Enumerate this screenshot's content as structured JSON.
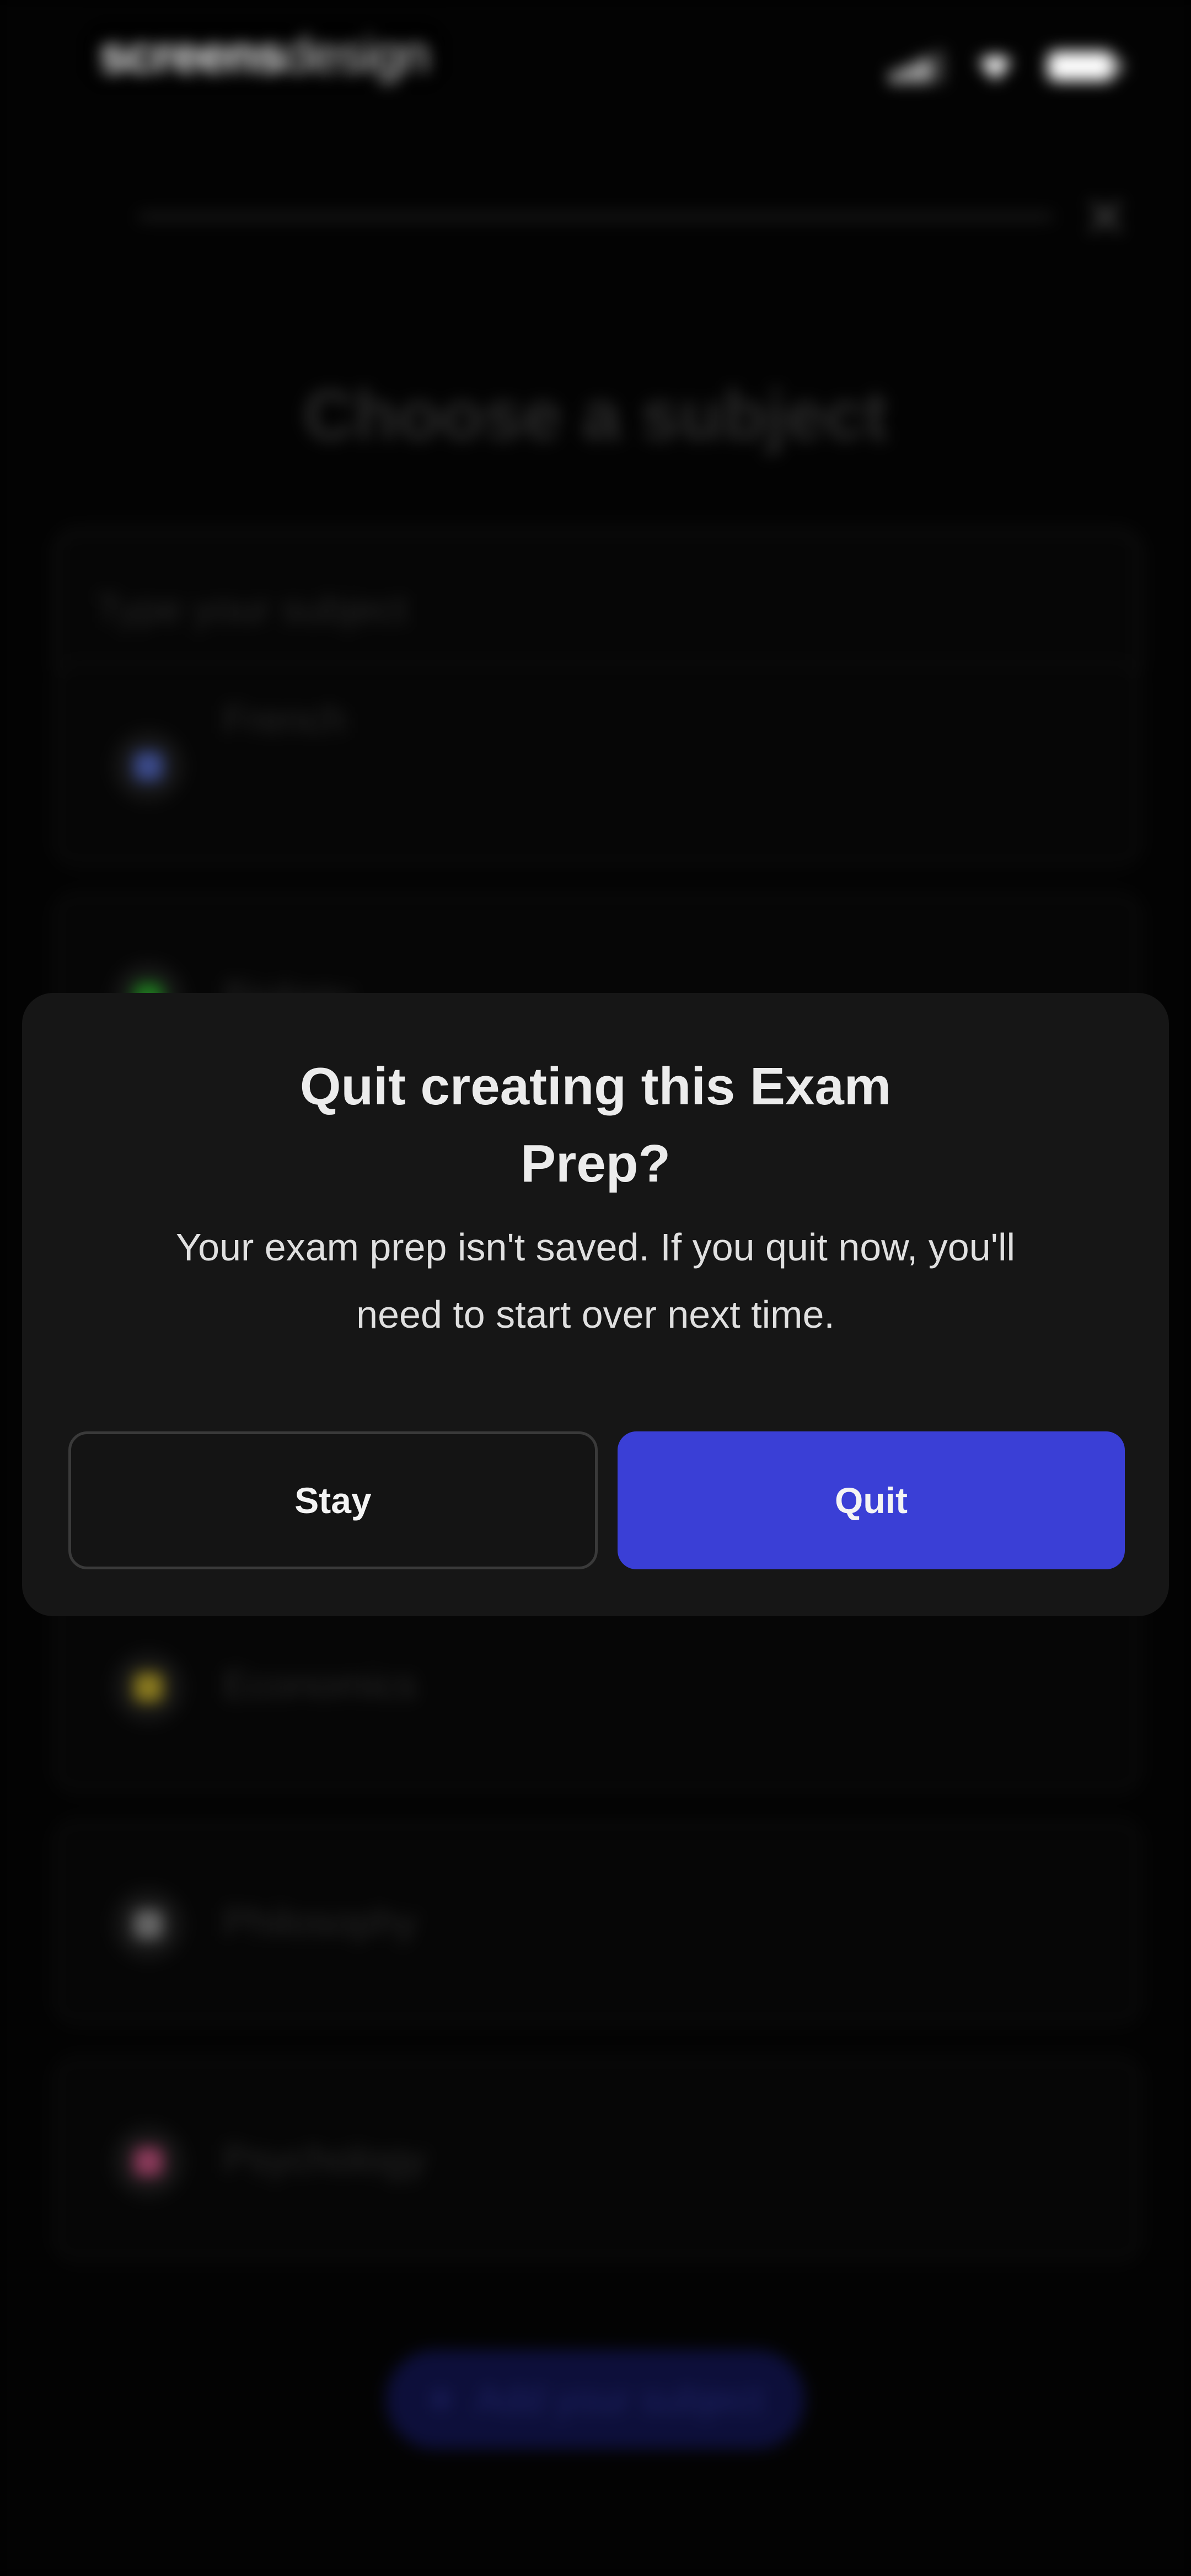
{
  "status_bar": {
    "brand_part1": "screens",
    "brand_part2": "design"
  },
  "background": {
    "close_symbol": "✕",
    "title": "Choose a subject",
    "search_placeholder": "Type your subject",
    "subjects": [
      {
        "label": "French",
        "icon": "flag-icon",
        "color": "#3b4a8a"
      },
      {
        "label": "Biology",
        "icon": "dna-icon",
        "color": "#1f7a1f"
      },
      {
        "label": "Economics",
        "icon": "money-bag-icon",
        "color": "#8a7a1f"
      },
      {
        "label": "Philosophy",
        "icon": "scroll-icon",
        "color": "#666666"
      },
      {
        "label": "Psychology",
        "icon": "brain-icon",
        "color": "#8a3a5a"
      }
    ],
    "add_button_label": "Add your subject",
    "add_button_plus": "+"
  },
  "dialog": {
    "title_line1": "Quit creating this Exam",
    "title_line2": "Prep?",
    "message_line1": "Your exam prep isn't saved. If you quit now, you'll",
    "message_line2": "need to start over next time.",
    "stay_label": "Stay",
    "quit_label": "Quit",
    "quit_color": "#3a3fd6"
  }
}
